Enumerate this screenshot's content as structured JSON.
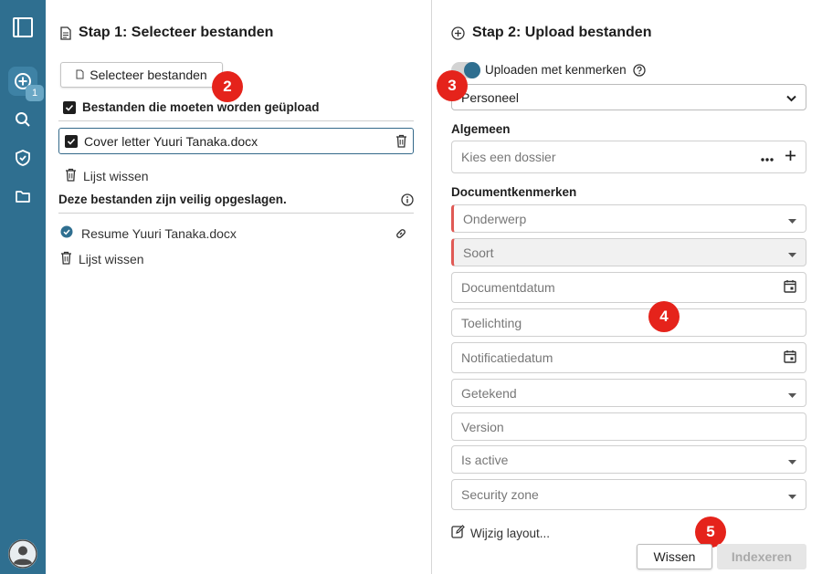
{
  "sidebar": {
    "badge": "1"
  },
  "step1": {
    "title": "Stap 1: Selecteer bestanden",
    "select_button": "Selecteer bestanden",
    "to_upload_label": "Bestanden die moeten worden geüpload",
    "file_name": "Cover letter Yuuri Tanaka.docx",
    "clear_list": "Lijst wissen",
    "saved_label": "Deze bestanden zijn veilig opgeslagen.",
    "saved_file": "Resume Yuuri Tanaka.docx",
    "clear_list_2": "Lijst wissen"
  },
  "step2": {
    "title": "Stap 2: Upload bestanden",
    "toggle_label": "Uploaden met kenmerken",
    "toggle_on": true,
    "profile_value": "Personeel",
    "general_label": "Algemeen",
    "dossier_placeholder": "Kies een dossier",
    "attributes_label": "Documentkenmerken",
    "fields": {
      "subject": "Onderwerp",
      "type": "Soort",
      "document_date": "Documentdatum",
      "explanation": "Toelichting",
      "notification_date": "Notificatiedatum",
      "signed": "Getekend",
      "version": "Version",
      "is_active": "Is active",
      "security_zone": "Security zone"
    },
    "edit_layout": "Wijzig layout...",
    "clear_button": "Wissen",
    "index_button": "Indexeren"
  },
  "markers": {
    "m2": "2",
    "m3": "3",
    "m4": "4",
    "m5": "5"
  },
  "colors": {
    "sidebar": "#2f6f90",
    "accent": "#2f6f90",
    "marker": "#e5231b",
    "required": "#e05a55"
  }
}
